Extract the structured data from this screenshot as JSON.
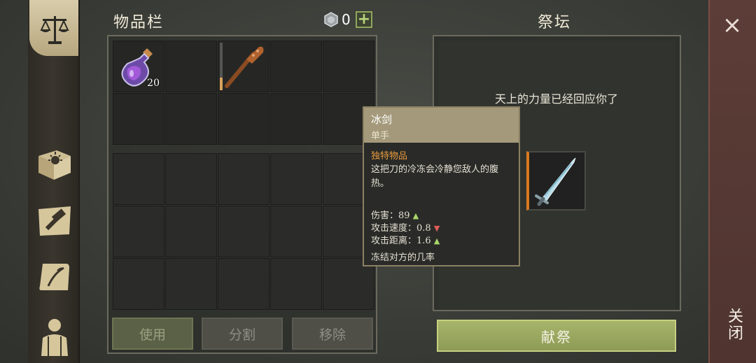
{
  "inventory": {
    "title": "物品栏",
    "currency": {
      "value": "0",
      "add_symbol": "+"
    },
    "items": [
      {
        "icon": "potion-icon",
        "count": "20"
      },
      {
        "icon": "club-icon"
      }
    ],
    "buttons": {
      "use": "使用",
      "split": "分割",
      "remove": "移除"
    }
  },
  "altar": {
    "title": "祭坛",
    "message": "天上的力量已经回应你了",
    "sacrifice_label": "献祭"
  },
  "tooltip": {
    "name": "冰剑",
    "type": "单手",
    "rarity": "独特物品",
    "description": "这把刀的冷冻会冷静您敌人的腹热。",
    "stats": [
      {
        "label": "伤害：",
        "value": "89",
        "trend": "up"
      },
      {
        "label": "攻击速度：",
        "value": "0.8",
        "trend": "down"
      },
      {
        "label": "攻击距离：",
        "value": "1.6",
        "trend": "up"
      }
    ],
    "effect": "冻结对方的几率"
  },
  "close": {
    "symbol": "×",
    "label": "关闭"
  },
  "colors": {
    "accent_orange": "#e99a3c",
    "sacrifice_green": "#a7b46a",
    "close_red": "#5d3d37"
  }
}
